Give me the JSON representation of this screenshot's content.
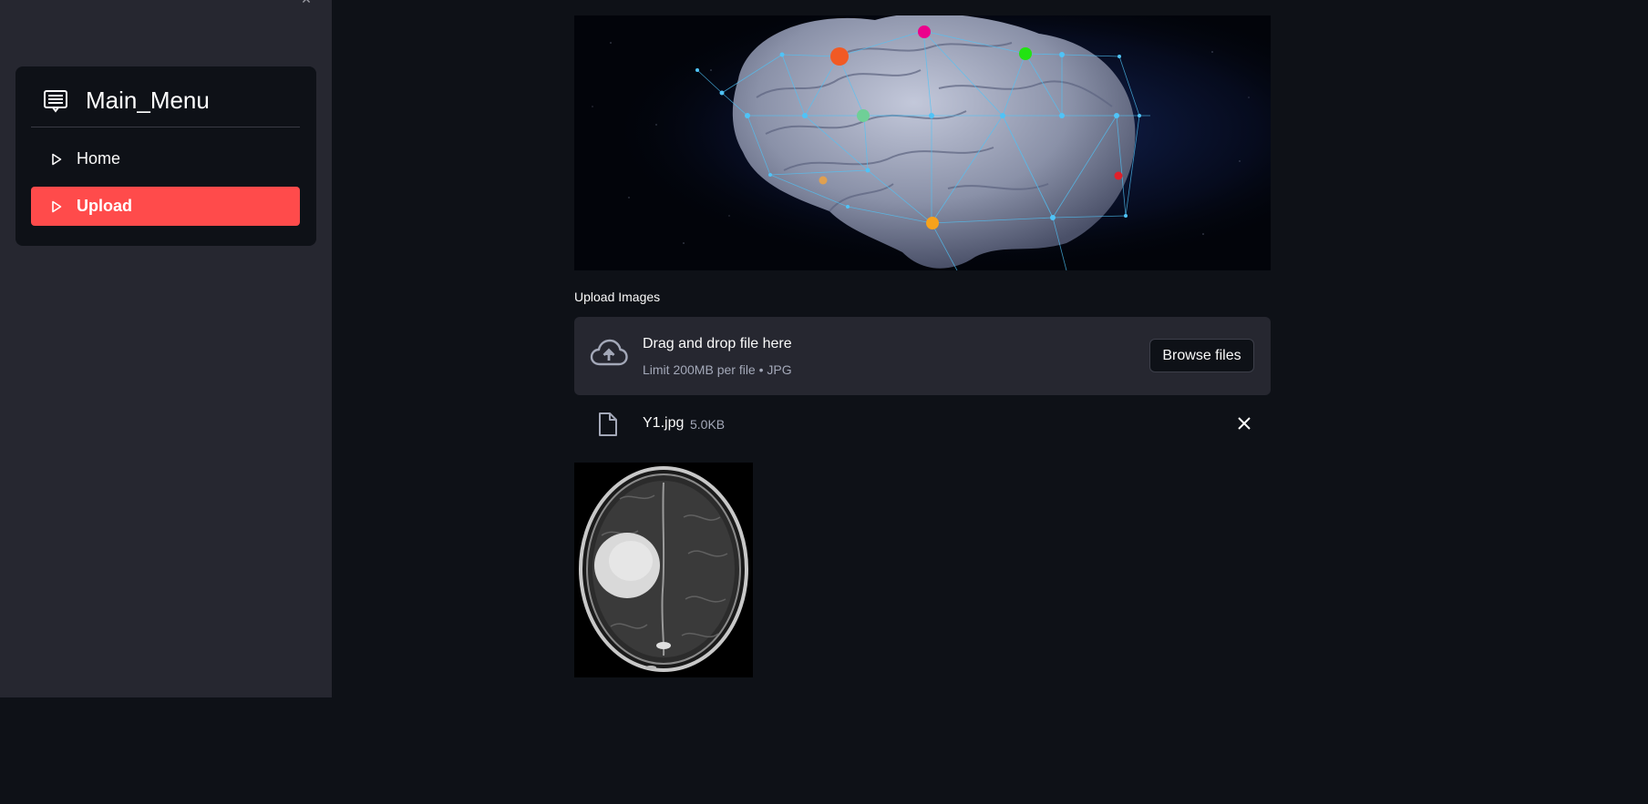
{
  "sidebar": {
    "menu_title": "Main_Menu",
    "items": [
      {
        "label": "Home",
        "icon": "play-outline-icon",
        "active": false
      },
      {
        "label": "Upload",
        "icon": "play-outline-icon",
        "active": true
      }
    ],
    "active_color": "#ff4b4b"
  },
  "main": {
    "uploader": {
      "label": "Upload Images",
      "drop_text": "Drag and drop file here",
      "limit_text": "Limit 200MB per file • JPG",
      "browse_label": "Browse files",
      "icon": "cloud-upload-icon"
    },
    "file": {
      "name": "Y1.jpg",
      "size": "5.0KB",
      "icon": "file-icon"
    }
  },
  "colors": {
    "background": "#0e1117",
    "sidebar": "#262730",
    "accent": "#ff4b4b"
  }
}
